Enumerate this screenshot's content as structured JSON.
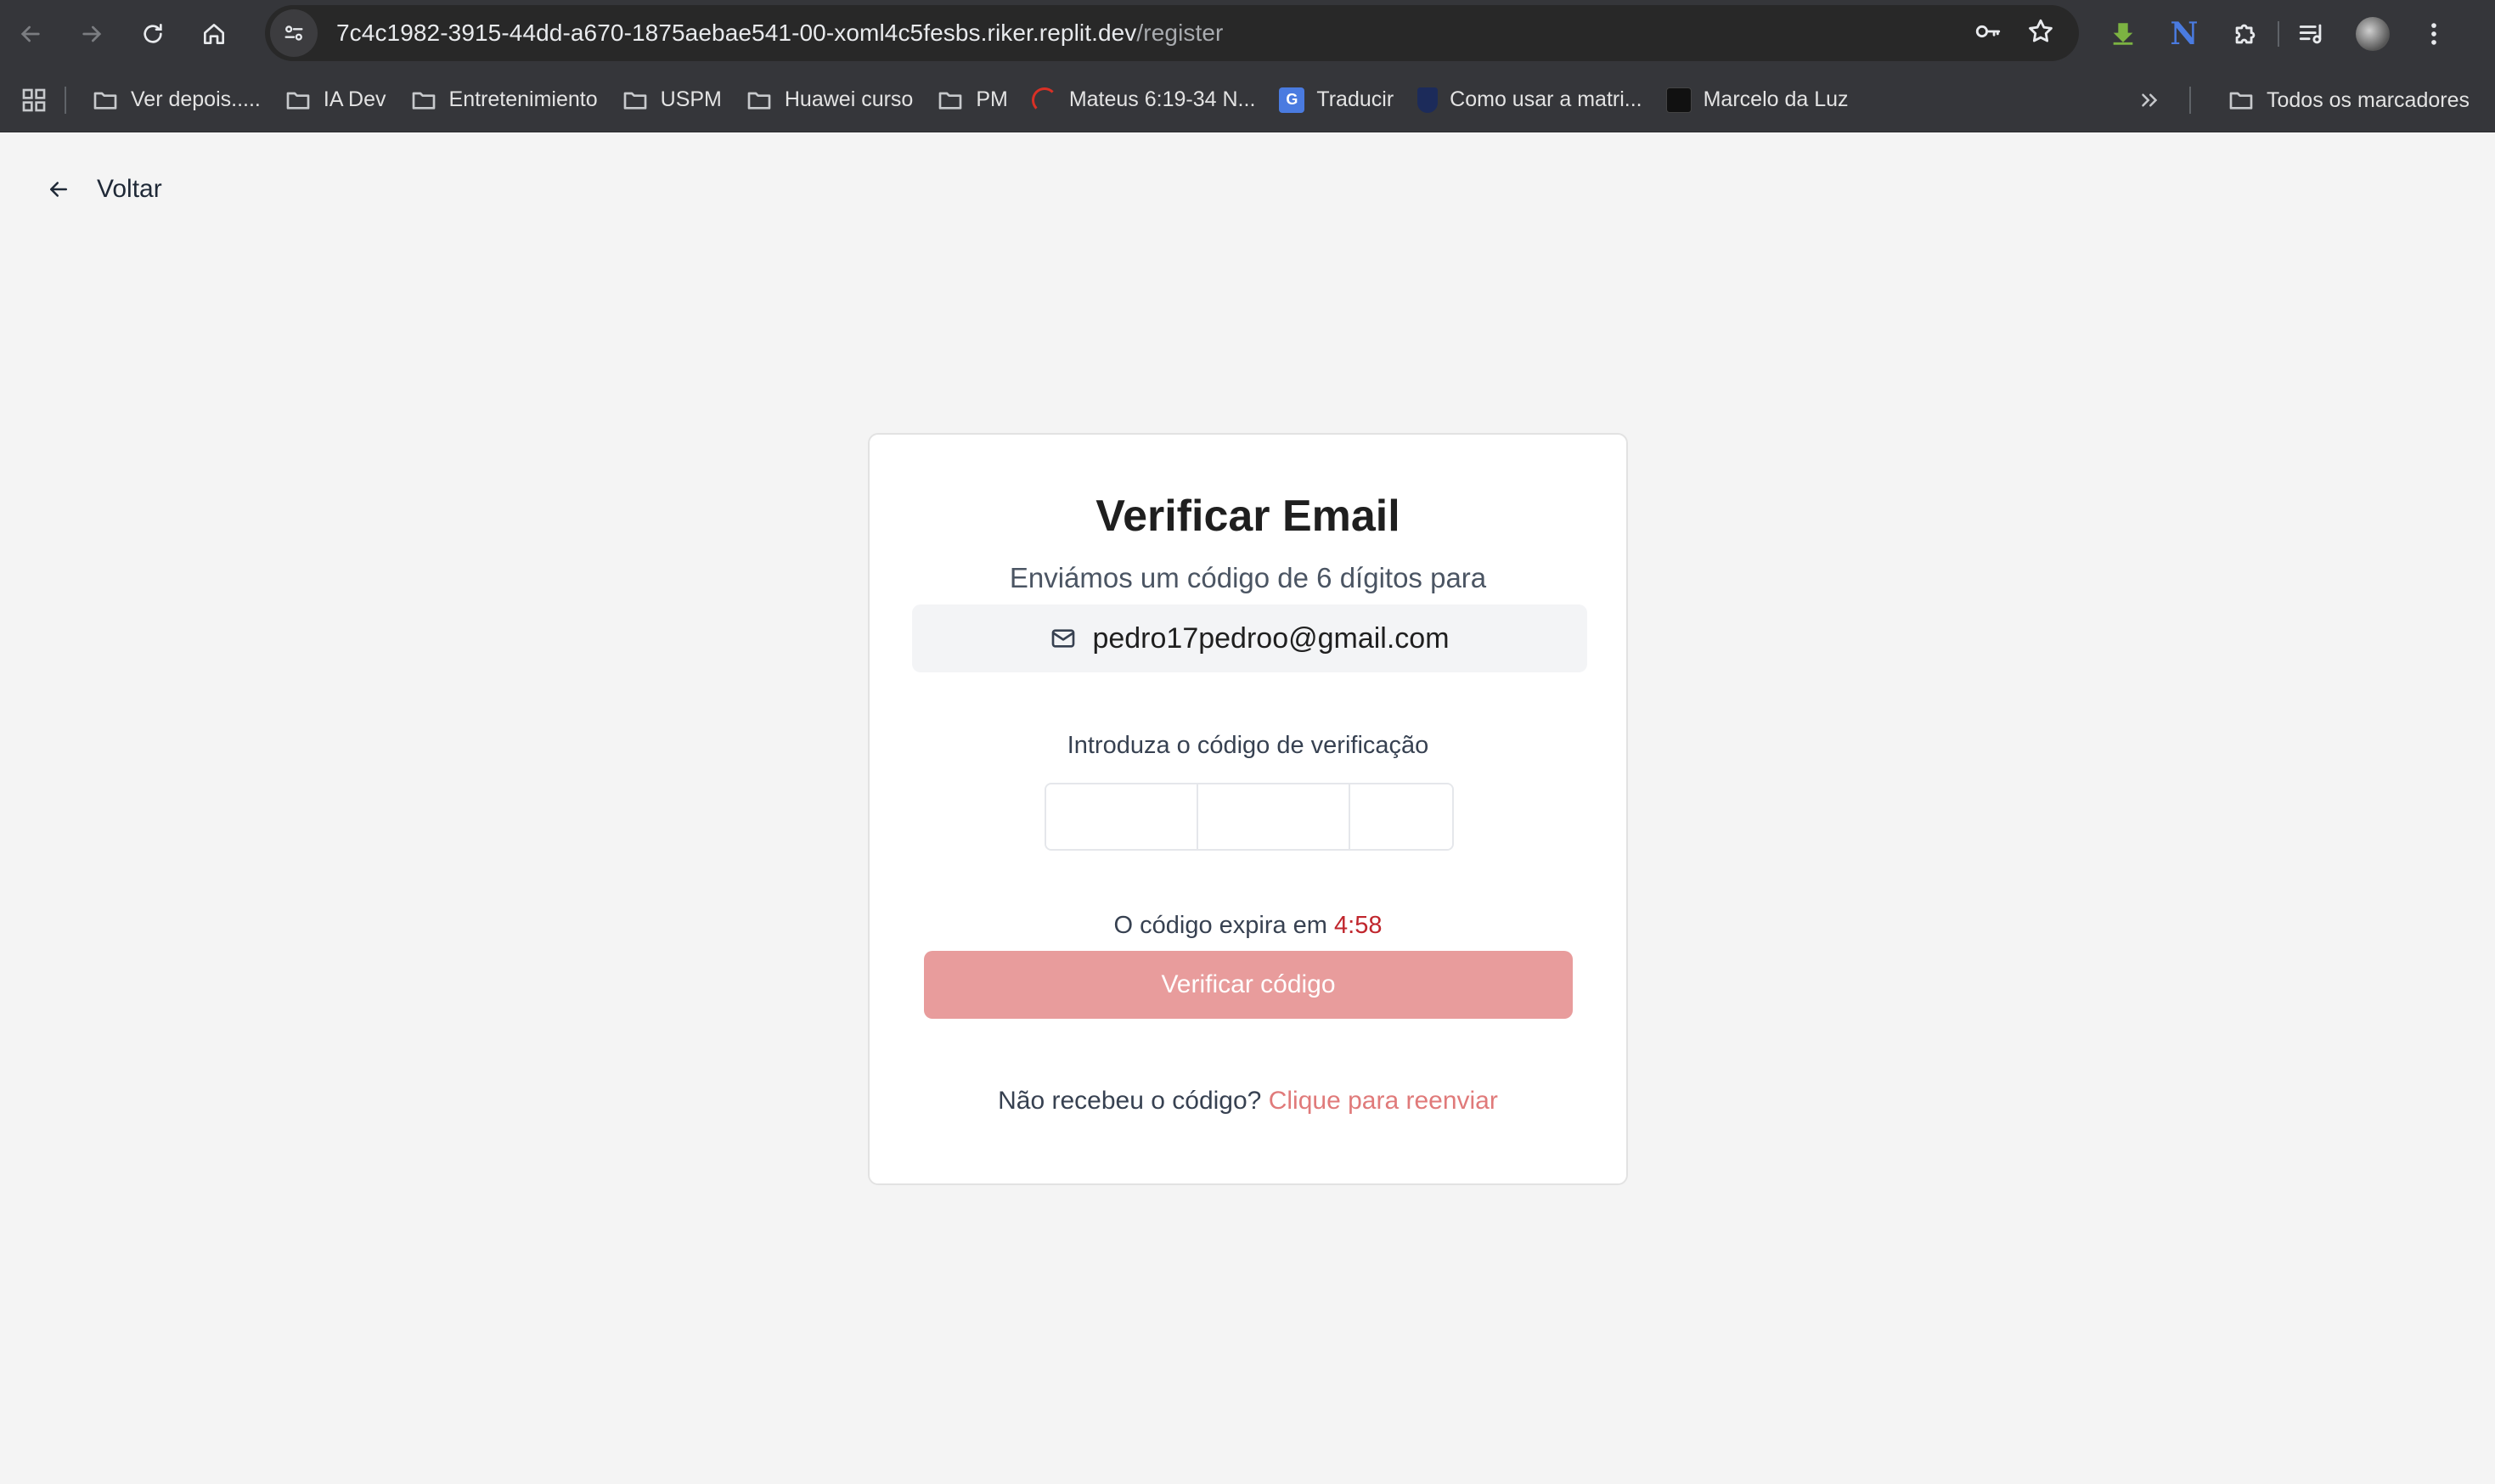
{
  "browser": {
    "url_host": "7c4c1982-3915-44dd-a670-1875aebae541-00-xoml4c5fesbs.riker.replit.dev",
    "url_path": "/register",
    "nav_icons": [
      "back-icon",
      "forward-icon",
      "reload-icon",
      "home-icon"
    ],
    "extension_icons": [
      "download-icon",
      "n-extension-icon",
      "puzzle-icon",
      "media-icon",
      "profile-avatar",
      "menu-icon"
    ],
    "extension_n_glyph": "N"
  },
  "bookmarks": {
    "items": [
      {
        "label": "Ver depois.....",
        "icon": "folder-icon"
      },
      {
        "label": "IA Dev",
        "icon": "folder-icon"
      },
      {
        "label": "Entretenimiento",
        "icon": "folder-icon"
      },
      {
        "label": "USPM",
        "icon": "folder-icon"
      },
      {
        "label": "Huawei curso",
        "icon": "folder-icon"
      },
      {
        "label": "PM",
        "icon": "folder-icon"
      },
      {
        "label": "Mateus 6:19-34 N...",
        "icon": "site-favicon"
      },
      {
        "label": "Traducir",
        "icon": "translate-favicon"
      },
      {
        "label": "Como usar a matri...",
        "icon": "shield-favicon"
      },
      {
        "label": "Marcelo da Luz",
        "icon": "site-favicon"
      }
    ],
    "all_bookmarks": "Todos os marcadores"
  },
  "page": {
    "back_label": "Voltar",
    "title": "Verificar Email",
    "subtitle": "Enviámos um código de 6 dígitos para",
    "email": "pedro17pedroo@gmail.com",
    "code_label": "Introduza o código de verificação",
    "code_length": 6,
    "expiry_prefix": "O código expira em",
    "expiry_time": "4:58",
    "verify_button": "Verificar código",
    "resend_prompt": "Não recebeu o código?",
    "resend_link": "Clique para reenviar"
  },
  "colors": {
    "accent_button": "#e89c9c",
    "resend_link": "#e07a7a",
    "expiry_time": "#c0262d",
    "chrome_bg": "#35363a",
    "page_bg": "#f4f4f4"
  }
}
